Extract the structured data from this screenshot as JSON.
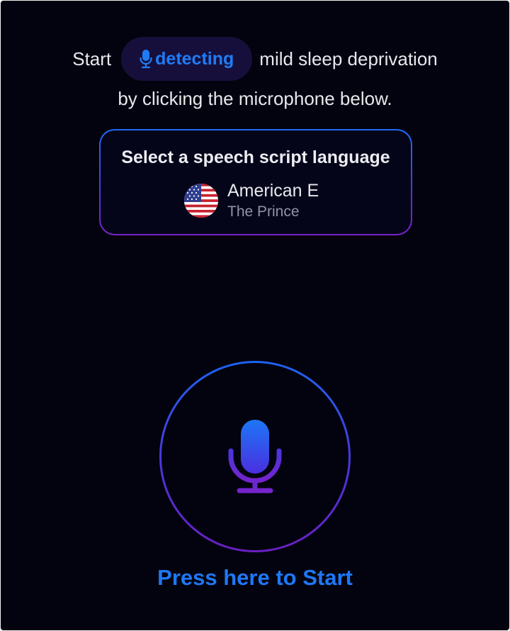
{
  "intro": {
    "prefix": "Start",
    "pill_label": "detecting",
    "suffix": "mild sleep deprivation",
    "line2": "by clicking the microphone below."
  },
  "language_card": {
    "heading": "Select a speech script language",
    "language_name": "American E",
    "script_name": "The Prince",
    "flag_icon": "us-flag-icon"
  },
  "microphone": {
    "icon": "microphone-icon",
    "start_label": "Press here to Start"
  },
  "colors": {
    "background": "#03030f",
    "accent_blue": "#1e78f5",
    "accent_purple": "#6a1fc2",
    "pill_background": "#170f3b"
  }
}
